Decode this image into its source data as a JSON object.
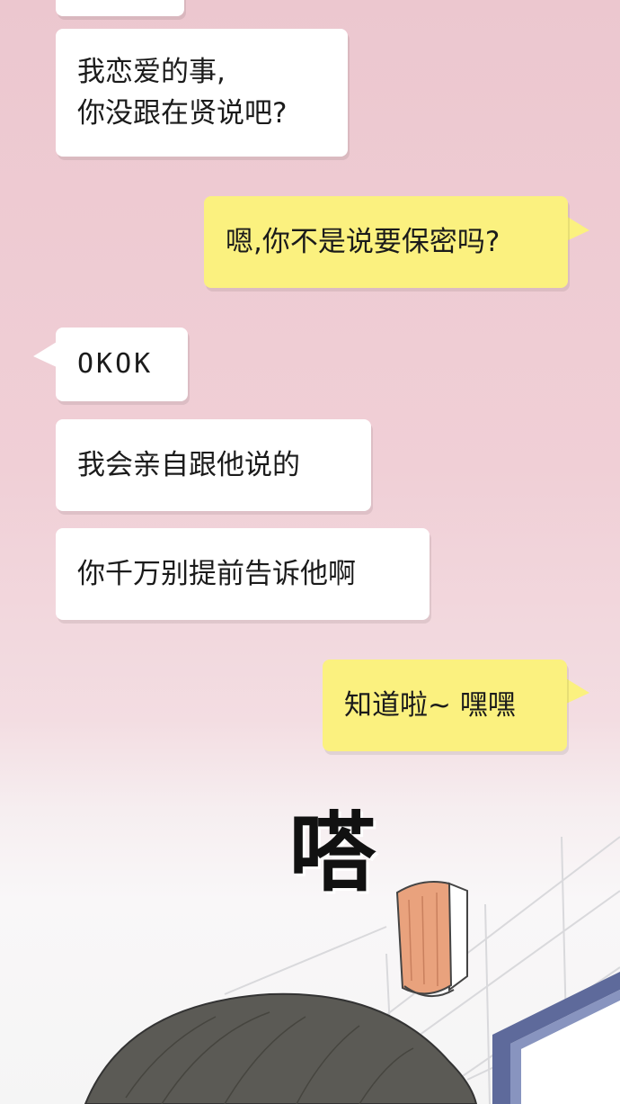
{
  "messages": [
    {
      "side": "left",
      "text": ""
    },
    {
      "side": "left",
      "text": "我恋爱的事,\n你没跟在贤说吧?"
    },
    {
      "side": "right",
      "text": "嗯,你不是说要保密吗?"
    },
    {
      "side": "left",
      "text": "OKOK"
    },
    {
      "side": "left",
      "text": "我会亲自跟他说的"
    },
    {
      "side": "left",
      "text": "你千万别提前告诉他啊"
    },
    {
      "side": "right",
      "text": "知道啦~ 嘿嘿"
    }
  ],
  "sound_effect": "嗒",
  "colors": {
    "background_pink": "#ecc7cf",
    "bubble_white": "#ffffff",
    "bubble_yellow": "#fbf17f",
    "hair": "#5b5a55",
    "lamp": "#e9a27d",
    "window_frame": "#5e6a9b"
  }
}
